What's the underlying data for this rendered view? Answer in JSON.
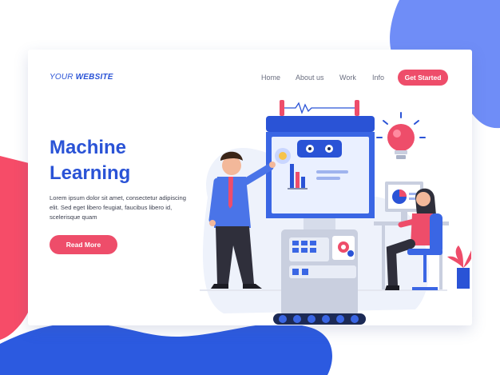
{
  "header": {
    "logo_prefix": "YOUR ",
    "logo_suffix": "WEBSITE",
    "nav": [
      "Home",
      "About us",
      "Work",
      "Info"
    ],
    "cta_label": "Get Started"
  },
  "hero": {
    "title_line1": "Machine",
    "title_line2": "Learning",
    "body": "Lorem ipsum dolor sit amet, consectetur adipiscing elit. Sed eget libero feugiat, faucibus libero id, scelerisque quam",
    "button_label": "Read More"
  },
  "colors": {
    "primary": "#2a53d6",
    "accent": "#ee4d6a",
    "blob_blue": "#6f8df7",
    "blob_pink": "#f64c68",
    "blob_dark_blue": "#2c5ae0"
  },
  "illustration": {
    "icons": [
      "robot-screen-icon",
      "lightbulb-icon",
      "gear-icon",
      "bar-chart-icon",
      "pie-chart-icon",
      "plant-icon"
    ]
  }
}
